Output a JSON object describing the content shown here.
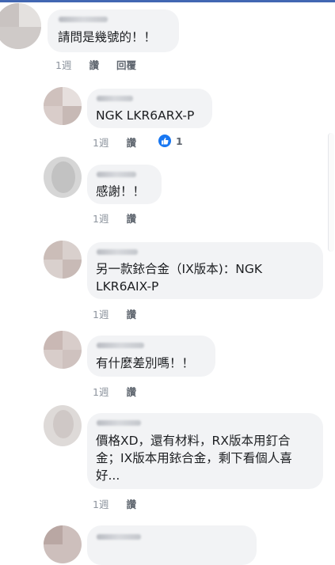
{
  "comments": [
    {
      "text": "請問是幾號的！！",
      "time": "1週",
      "like_label": "讚",
      "reply_label": "回覆"
    },
    {
      "text": "NGK LKR6ARX-P",
      "time": "1週",
      "like_label": "讚",
      "reaction_count": "1"
    },
    {
      "text": "感謝！！",
      "time": "1週",
      "like_label": "讚"
    },
    {
      "text": "另一款銥合金（IX版本)：NGK\nLKR6AIX-P",
      "time": "1週",
      "like_label": "讚"
    },
    {
      "text": "有什麼差別嗎！！",
      "time": "1週",
      "like_label": "讚"
    },
    {
      "text": "價格XD，還有材料，RX版本用釘合\n金；IX版本用銥合金，剩下看個人喜\n好...",
      "time": "1週",
      "like_label": "讚"
    }
  ],
  "colors": {
    "accent": "#1877f2",
    "bubble": "#f2f3f5",
    "meta": "#8d949e"
  },
  "icons": {
    "reaction": "thumbs-up-icon"
  }
}
